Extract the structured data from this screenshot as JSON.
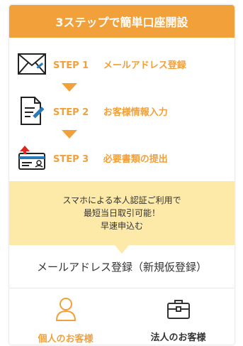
{
  "header": {
    "title": "3ステップで簡単口座開設"
  },
  "steps": [
    {
      "num": "STEP 1",
      "label": "メールアドレス登録",
      "icon": "envelope-icon"
    },
    {
      "num": "STEP 2",
      "label": "お客様情報入力",
      "icon": "document-pen-icon"
    },
    {
      "num": "STEP 3",
      "label": "必要書類の提出",
      "icon": "id-card-upload-icon"
    }
  ],
  "notice": {
    "line1": "スマホによる本人認証ご利用で",
    "line2": "最短当日取引可能！",
    "line3": "早速申込む"
  },
  "section": {
    "title": "メールアドレス登録（新規仮登録）"
  },
  "options": [
    {
      "label": "個人のお客様",
      "icon": "person-icon"
    },
    {
      "label": "法人のお客様",
      "icon": "briefcase-icon"
    }
  ],
  "colors": {
    "accent": "#f2a03a",
    "notice_bg": "#fde9a8"
  }
}
